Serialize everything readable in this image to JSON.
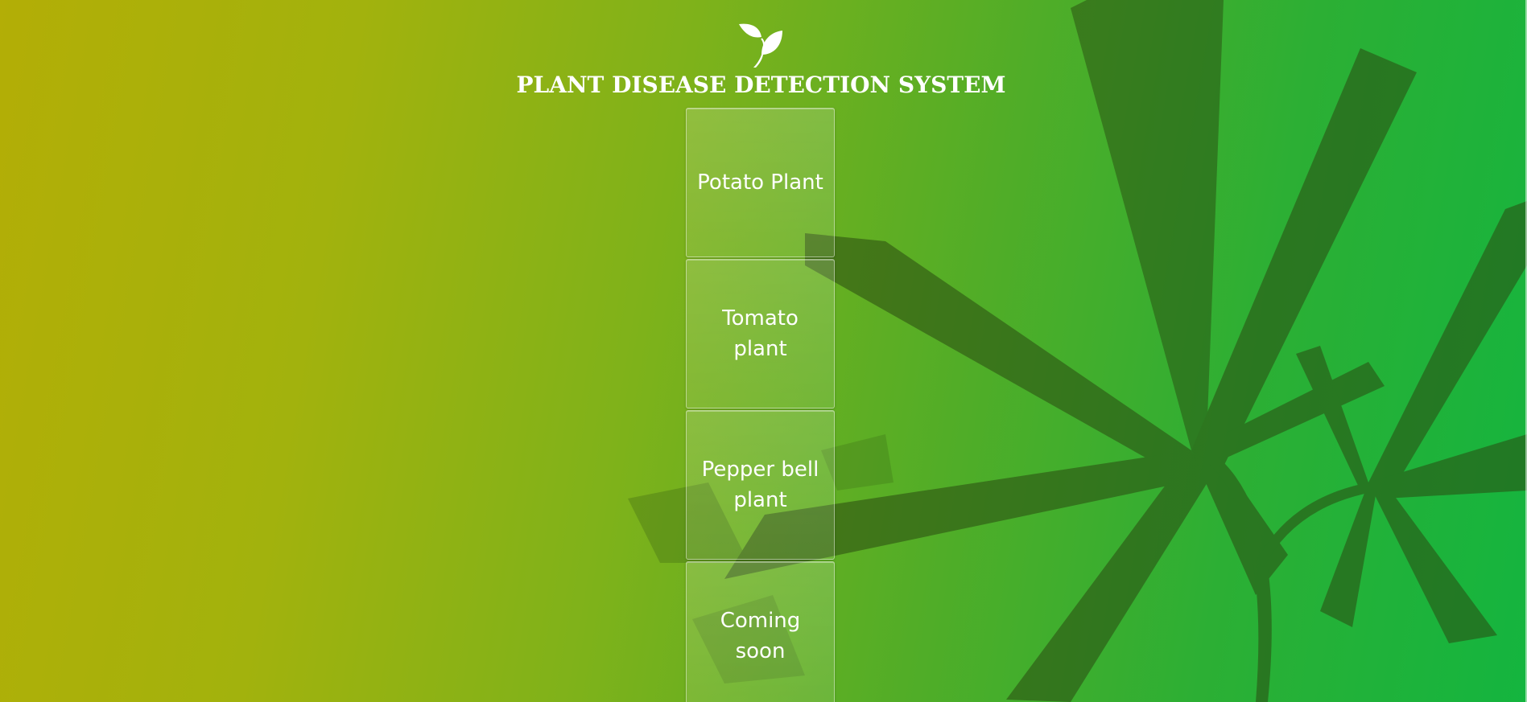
{
  "app": {
    "title": "PLANT DISEASE DETECTION SYSTEM",
    "logo_icon": "leaf-icon"
  },
  "cards": [
    {
      "label": "Potato Plant"
    },
    {
      "label": "Tomato plant"
    },
    {
      "label": "Pepper bell plant"
    },
    {
      "label": "Coming soon"
    }
  ],
  "colors": {
    "gradient_start": "#b3ae06",
    "gradient_end": "#14b53f",
    "text": "#ffffff",
    "leaf_dark": "#1e4a12"
  }
}
